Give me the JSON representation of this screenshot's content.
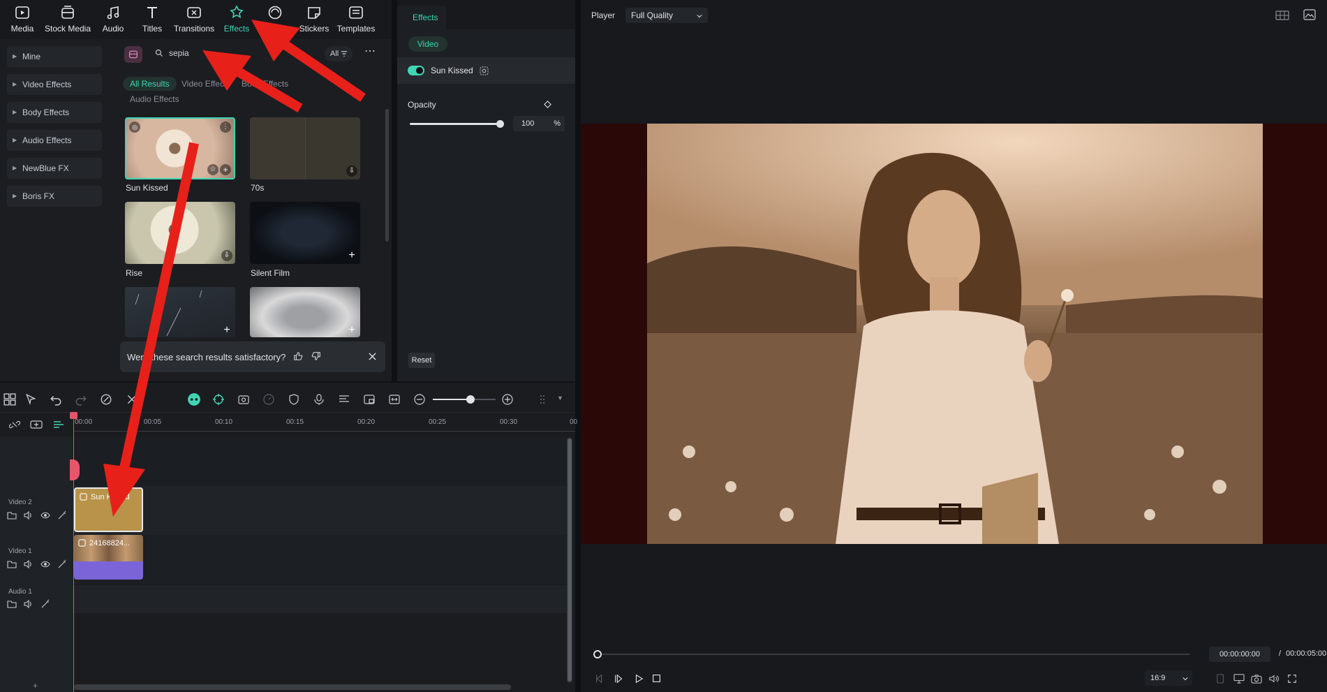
{
  "toolbar": {
    "items": [
      {
        "label": "Media",
        "icon": "media-icon"
      },
      {
        "label": "Stock Media",
        "icon": "stock-media-icon"
      },
      {
        "label": "Audio",
        "icon": "music-note-icon"
      },
      {
        "label": "Titles",
        "icon": "text-t-icon"
      },
      {
        "label": "Transitions",
        "icon": "transitions-icon"
      },
      {
        "label": "Effects",
        "icon": "effects-sparkle-icon"
      },
      {
        "label": "Filters",
        "icon": "filters-icon"
      },
      {
        "label": "Stickers",
        "icon": "stickers-icon"
      },
      {
        "label": "Templates",
        "icon": "templates-icon"
      }
    ],
    "active": "Effects",
    "accent_color": "#3ed6b3"
  },
  "sidebar": {
    "items": [
      {
        "label": "Mine"
      },
      {
        "label": "Video Effects"
      },
      {
        "label": "Body Effects"
      },
      {
        "label": "Audio Effects"
      },
      {
        "label": "NewBlue FX"
      },
      {
        "label": "Boris FX"
      }
    ]
  },
  "library": {
    "search_value": "sepia",
    "filter_label": "All",
    "tags": [
      "All Results",
      "Video Effects",
      "Body Effects",
      "Audio Effects"
    ],
    "active_tag": "All Results",
    "results": [
      {
        "label": "Sun Kissed"
      },
      {
        "label": "70s"
      },
      {
        "label": "Rise"
      },
      {
        "label": "Silent Film"
      },
      {
        "label": ""
      },
      {
        "label": ""
      }
    ],
    "feedback_text": "Were these search results satisfactory?"
  },
  "properties": {
    "tab": "Effects",
    "sub_tab": "Video",
    "effect_name": "Sun Kissed",
    "effect_enabled": true,
    "opacity_label": "Opacity",
    "opacity_value": "100",
    "opacity_unit": "%",
    "opacity_fraction": 1.0,
    "reset_label": "Reset"
  },
  "player": {
    "label": "Player",
    "quality": "Full Quality",
    "current_time": "00:00:00:00",
    "separator": "/",
    "total_time": "00:00:05:00",
    "aspect": "16:9",
    "playhead_fraction": 0.0
  },
  "timeline": {
    "ruler_ticks": [
      "00:00",
      "00:05",
      "00:10",
      "00:15",
      "00:20",
      "00:25",
      "00:30",
      "00"
    ],
    "tracks": [
      {
        "label": "Video 2"
      },
      {
        "label": "Video 1"
      },
      {
        "label": "Audio 1"
      }
    ],
    "clips": {
      "effect_clip": "Sun Kissed",
      "video_clip": "24168824..."
    },
    "zoom_fraction": 0.6
  },
  "colors": {
    "accent": "#3ed6b3",
    "annotation_arrow": "#e8201a",
    "effect_clip": "#b9934a",
    "video_clip_bar": "#7b64d8"
  }
}
